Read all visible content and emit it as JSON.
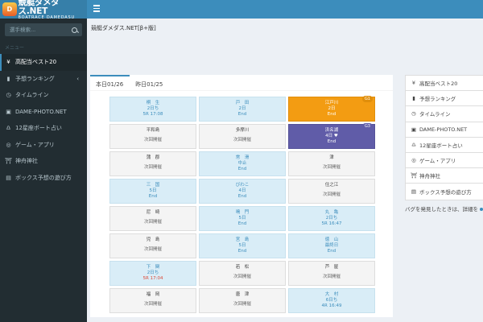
{
  "logo": {
    "main": "競艇ダメダス.NET",
    "sub": "BOATRACE DAMEDASU",
    "badge": "D"
  },
  "search": {
    "placeholder": "選手検索..."
  },
  "sidebar": {
    "menu_header": "メニュー",
    "items": [
      {
        "label": "高配当ベスト20",
        "icon": "yen-icon",
        "glyph": "¥"
      },
      {
        "label": "予想ランキング",
        "icon": "bar-chart-icon",
        "glyph": "▮"
      },
      {
        "label": "タイムライン",
        "icon": "clock-icon",
        "glyph": "◷"
      },
      {
        "label": "DAME-PHOTO.NET",
        "icon": "camera-icon",
        "glyph": "▣"
      },
      {
        "label": "12星座ボート占い",
        "icon": "zodiac-icon",
        "glyph": "♎"
      },
      {
        "label": "ゲーム・アプリ",
        "icon": "gamepad-icon",
        "glyph": "◎"
      },
      {
        "label": "神舟神社",
        "icon": "shrine-icon",
        "glyph": "⛩"
      },
      {
        "label": "ボックス予想の遊び方",
        "icon": "document-icon",
        "glyph": "▤"
      }
    ]
  },
  "header": {
    "site_title": "競艇ダメダス.NET[β+版]"
  },
  "tabs": [
    "本日01/26",
    "昨日01/25"
  ],
  "venues": [
    {
      "l1": "桐　生",
      "l2": "2日ち",
      "l3": "5R 17:08",
      "style": "blue"
    },
    {
      "l1": "戸　田",
      "l2": "2日",
      "l3": "End",
      "style": "blue"
    },
    {
      "l1": "江戸川",
      "l2": "2日",
      "l3": "End",
      "style": "orange",
      "badge": "G1"
    },
    {
      "l1": "平和島",
      "l2": "次回開催",
      "style": "gray"
    },
    {
      "l1": "多摩川",
      "l2": "次回開催",
      "style": "gray"
    },
    {
      "l1": "浜名湖",
      "l2": "4日 ♥",
      "l3": "End",
      "style": "purple",
      "badge": "G3"
    },
    {
      "l1": "蒲　郡",
      "l2": "次回開催",
      "style": "gray"
    },
    {
      "l1": "常　滑",
      "l2": "中止",
      "l3": "End",
      "style": "blue"
    },
    {
      "l1": "津",
      "l2": "次回開催",
      "style": "gray"
    },
    {
      "l1": "三　国",
      "l2": "5日",
      "l3": "End",
      "style": "blue"
    },
    {
      "l1": "びわこ",
      "l2": "4日",
      "l3": "End",
      "style": "blue"
    },
    {
      "l1": "住之江",
      "l2": "次回開催",
      "style": "gray"
    },
    {
      "l1": "尼　崎",
      "l2": "次回開催",
      "style": "gray"
    },
    {
      "l1": "鳴　門",
      "l2": "5日",
      "l3": "End",
      "style": "blue"
    },
    {
      "l1": "丸　亀",
      "l2": "2日ち",
      "l3": "5R 16:47",
      "style": "blue"
    },
    {
      "l1": "児　島",
      "l2": "次回開催",
      "style": "gray"
    },
    {
      "l1": "宮　島",
      "l2": "5日",
      "l3": "End",
      "style": "blue"
    },
    {
      "l1": "徳　山",
      "l2": "最終日",
      "l3": "End",
      "style": "blue"
    },
    {
      "l1": "下　関",
      "l2": "2日ち",
      "l3": "5R 17:04",
      "style": "blue",
      "red": true
    },
    {
      "l1": "若　松",
      "l2": "次回開催",
      "style": "gray"
    },
    {
      "l1": "芦　屋",
      "l2": "次回開催",
      "style": "gray"
    },
    {
      "l1": "福　岡",
      "l2": "次回開催",
      "style": "gray"
    },
    {
      "l1": "唐　津",
      "l2": "次回開催",
      "style": "gray"
    },
    {
      "l1": "大　村",
      "l2": "6日ち",
      "l3": "4R 16:49",
      "style": "blue"
    }
  ],
  "right_menu": [
    {
      "label": "高配当ベスト20",
      "icon": "yen-icon",
      "glyph": "¥"
    },
    {
      "label": "予想ランキング",
      "icon": "bar-chart-icon",
      "glyph": "▮"
    },
    {
      "label": "タイムライン",
      "icon": "clock-icon",
      "glyph": "◷"
    },
    {
      "label": "DAME-PHOTO.NET",
      "icon": "camera-icon",
      "glyph": "▣"
    },
    {
      "label": "12星座ボート占い",
      "icon": "zodiac-icon",
      "glyph": "♎"
    },
    {
      "label": "ゲーム・アプリ",
      "icon": "gamepad-icon",
      "glyph": "◎"
    },
    {
      "label": "神舟神社",
      "icon": "shrine-icon",
      "glyph": "⛩"
    },
    {
      "label": "ボックス予想の遊び方",
      "icon": "document-icon",
      "glyph": "▤"
    }
  ],
  "bug_note": "バグを発見したときは、詳細を",
  "colors": {
    "primary": "#3c8dbc",
    "sidebar": "#222d32",
    "orange": "#f39c12",
    "purple": "#605ca8"
  }
}
